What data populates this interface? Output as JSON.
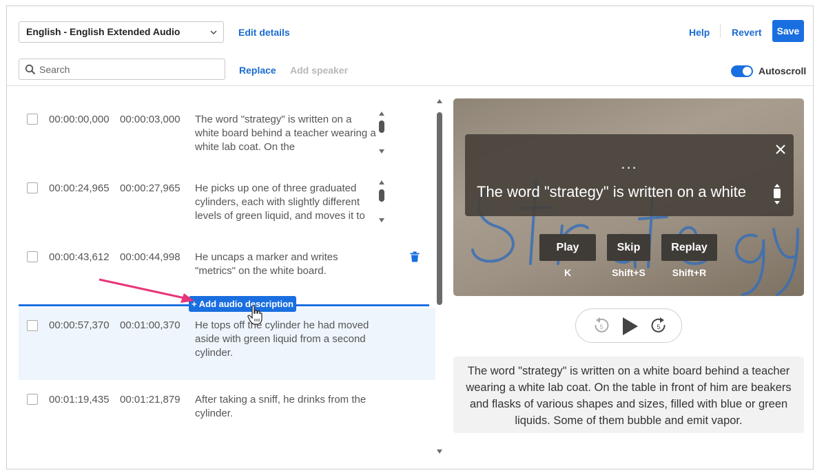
{
  "header": {
    "language_select": "English - English Extended Audio",
    "edit_details": "Edit details",
    "help": "Help",
    "revert": "Revert",
    "save": "Save"
  },
  "toolbar": {
    "search_placeholder": "Search",
    "replace": "Replace",
    "add_speaker": "Add speaker",
    "autoscroll": "Autoscroll",
    "autoscroll_on": true
  },
  "rows": [
    {
      "start": "00:00:00,000",
      "end": "00:00:03,000",
      "text": "The word \"strategy\" is written on a white board behind a teacher wearing a white lab coat. On the"
    },
    {
      "start": "00:00:24,965",
      "end": "00:00:27,965",
      "text": "He picks up one of three graduated cylinders, each with slightly different levels of green liquid, and moves it to"
    },
    {
      "start": "00:00:43,612",
      "end": "00:00:44,998",
      "text": "He uncaps a marker and writes \"metrics\" on the white board."
    },
    {
      "start": "00:00:57,370",
      "end": "00:01:00,370",
      "text": "He tops off the cylinder he had moved aside with green liquid from a second cylinder."
    },
    {
      "start": "00:01:19,435",
      "end": "00:01:21,879",
      "text": "After taking a sniff, he drinks from the cylinder."
    }
  ],
  "add_audio_description": "+ Add audio description",
  "player": {
    "overlay_dots": "...",
    "caption": "The word \"strategy\" is written on a white",
    "buttons": [
      {
        "label": "Play",
        "key": "K"
      },
      {
        "label": "Skip",
        "key": "Shift+S"
      },
      {
        "label": "Replay",
        "key": "Shift+R"
      }
    ],
    "rewind_seconds": "5",
    "forward_seconds": "5"
  },
  "transcript": "The word \"strategy\" is written on a white board behind a teacher wearing a white lab coat. On the table in front of him are beakers and flasks of various shapes and sizes, filled with blue or green liquids. Some of them bubble and emit vapor.",
  "colors": {
    "accent": "#1a6fe0",
    "link": "#1a6bd0",
    "highlight_row": "#eef5fd",
    "annotation_arrow": "#e8357a"
  }
}
